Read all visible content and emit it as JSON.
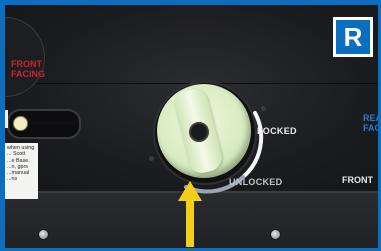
{
  "badge": {
    "letter": "R"
  },
  "labels": {
    "front_facing": "FRONT\nFACING",
    "rear_facing": "REAR\nFACING",
    "front_truncated": "FRONT",
    "locked": "LOCKED",
    "unlocked": "UNLOCKED"
  },
  "sticker": {
    "lines": [
      "when using",
      "... Scott",
      "...e Base.",
      "...n, gprs",
      "...manual",
      "...ns"
    ]
  },
  "colors": {
    "frame_blue": "#0a6fc0",
    "front_facing_red": "#c9262c",
    "rear_facing_blue": "#2a7bd8",
    "knob_green": "#d8ecc1",
    "arrow_yellow": "#f2d01a"
  },
  "icons": {
    "arrow": "up-arrow-icon",
    "knob": "rotary-lock-knob-icon",
    "screw": "screw-icon"
  }
}
